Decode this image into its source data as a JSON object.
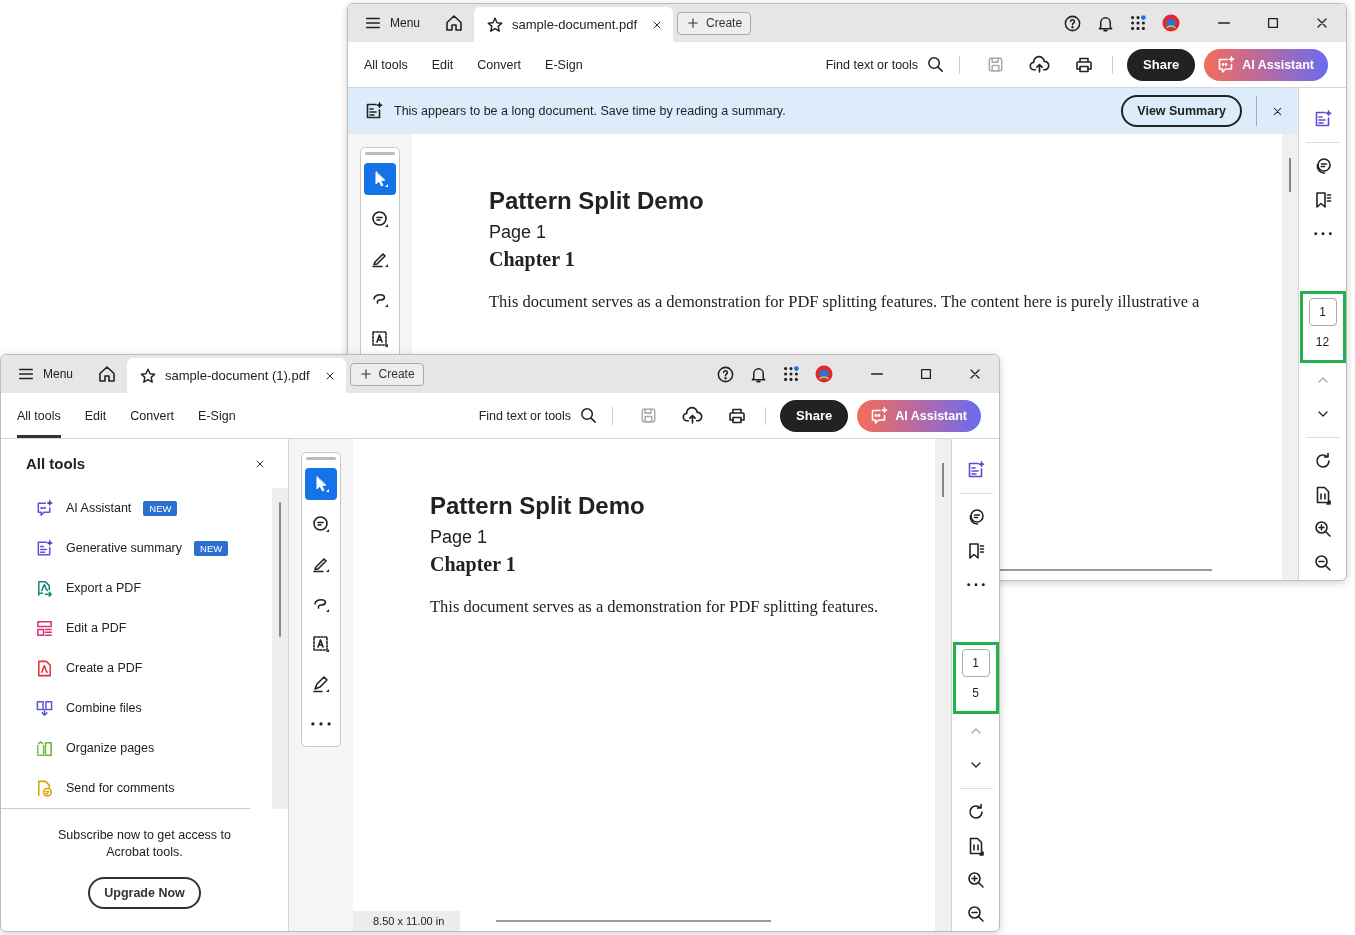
{
  "desktop": {
    "windows": [
      {
        "title_bar": {
          "menu_label": "Menu",
          "tab_title": "sample-document.pdf",
          "create_label": "Create"
        },
        "toolbar": {
          "tabs": [
            {
              "label": "All tools",
              "selected": false
            },
            {
              "label": "Edit",
              "selected": false
            },
            {
              "label": "Convert",
              "selected": false
            },
            {
              "label": "E-Sign",
              "selected": false
            }
          ],
          "search_label": "Find text or tools",
          "save_disabled": true,
          "share_label": "Share",
          "ai_label": "AI Assistant"
        },
        "banner": {
          "text": "This appears to be a long document. Save time by reading a summary.",
          "button": "View Summary"
        },
        "tools": [
          {
            "kind": "select",
            "selected": true
          },
          {
            "kind": "comment",
            "selected": false
          },
          {
            "kind": "highlight",
            "selected": false
          },
          {
            "kind": "draw",
            "selected": false
          },
          {
            "kind": "text-select",
            "selected": false
          }
        ],
        "document": {
          "title": "Pattern Split Demo",
          "subtitle": "Page 1",
          "heading": "Chapter 1",
          "paragraph": "This document serves as a demonstration for PDF splitting features. The content here is purely illustrative a"
        },
        "page_nav": {
          "current": "1",
          "total": "12",
          "previous_disabled": true
        }
      },
      {
        "title_bar": {
          "menu_label": "Menu",
          "tab_title": "sample-document (1).pdf",
          "create_label": "Create"
        },
        "toolbar": {
          "tabs": [
            {
              "label": "All tools",
              "selected": true
            },
            {
              "label": "Edit",
              "selected": false
            },
            {
              "label": "Convert",
              "selected": false
            },
            {
              "label": "E-Sign",
              "selected": false
            }
          ],
          "search_label": "Find text or tools",
          "save_disabled": true,
          "share_label": "Share",
          "ai_label": "AI Assistant"
        },
        "panel": {
          "title": "All tools",
          "items": [
            {
              "label": "AI Assistant",
              "badge": "NEW",
              "color": "#6a4bd8"
            },
            {
              "label": "Generative summary",
              "badge": "NEW",
              "color": "#6a4bd8"
            },
            {
              "label": "Export a PDF",
              "color": "#13877e"
            },
            {
              "label": "Edit a PDF",
              "color": "#d8307a"
            },
            {
              "label": "Create a PDF",
              "color": "#e0353a"
            },
            {
              "label": "Combine files",
              "color": "#5b58d8"
            },
            {
              "label": "Organize pages",
              "color": "#6ab43a"
            },
            {
              "label": "Send for comments",
              "color": "#d9a100"
            }
          ],
          "subscribe_text": "Subscribe now to get access to Acrobat tools.",
          "upgrade_label": "Upgrade Now"
        },
        "tools": [
          {
            "kind": "select",
            "selected": true
          },
          {
            "kind": "comment",
            "selected": false
          },
          {
            "kind": "highlight",
            "selected": false
          },
          {
            "kind": "draw",
            "selected": false
          },
          {
            "kind": "text-select",
            "selected": false
          },
          {
            "kind": "sign",
            "selected": false
          },
          {
            "kind": "more",
            "selected": false
          }
        ],
        "document": {
          "title": "Pattern Split Demo",
          "subtitle": "Page 1",
          "heading": "Chapter 1",
          "paragraph": "This document serves as a demonstration for PDF splitting features."
        },
        "status": "8.50 x 11.00 in",
        "page_nav": {
          "current": "1",
          "total": "5",
          "previous_disabled": true
        }
      }
    ]
  }
}
